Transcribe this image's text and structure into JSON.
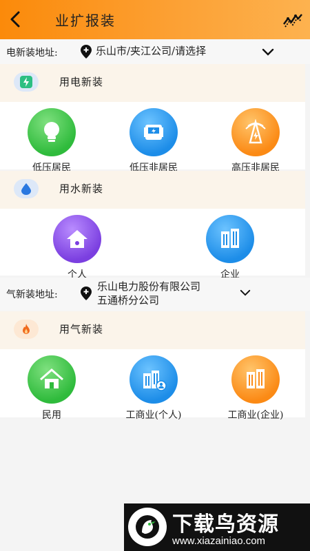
{
  "header": {
    "title": "业扩报装",
    "back_icon": "chevron-left-icon",
    "right_icon": "trend-icon"
  },
  "electric": {
    "address_label": "电新装地址:",
    "address_value": "乐山市/夹江公司/请选择",
    "section_title": "用电新装",
    "items": [
      {
        "label": "低压居民",
        "icon": "bulb-icon",
        "color": "#2fbb3c"
      },
      {
        "label": "低压非居民",
        "icon": "meter-icon",
        "color": "#1d8de8"
      },
      {
        "label": "高压非居民",
        "icon": "tower-icon",
        "color": "#fb8a15"
      }
    ]
  },
  "water": {
    "section_title": "用水新装",
    "items": [
      {
        "label": "个人",
        "icon": "house-icon",
        "color": "#7b3fe0"
      },
      {
        "label": "企业",
        "icon": "building-icon",
        "color": "#1d8de8"
      }
    ]
  },
  "gas": {
    "address_label": "气新装地址:",
    "address_line1": "乐山电力股份有限公司",
    "address_line2": "五通桥分公司",
    "section_title": "用气新装",
    "items": [
      {
        "label": "民用",
        "icon": "home-icon",
        "color": "#2fbb3c"
      },
      {
        "label": "工商业(个人)",
        "icon": "building-person-icon",
        "color": "#1d8de8"
      },
      {
        "label": "工商业(企业)",
        "icon": "building-icon",
        "color": "#fb8a15"
      }
    ]
  },
  "banner": {
    "title": "下载鸟资源",
    "url": "www.xiazainiao.com"
  }
}
